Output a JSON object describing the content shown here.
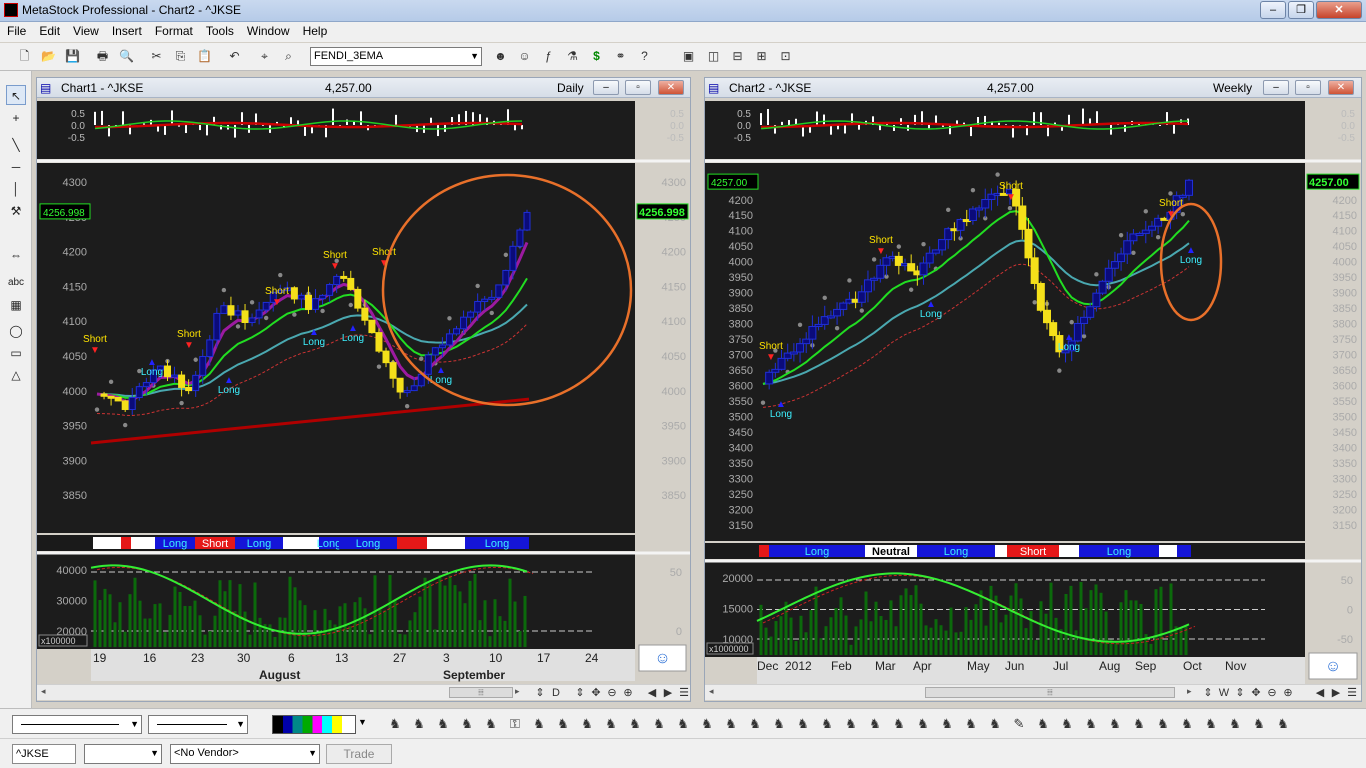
{
  "app": {
    "title": "MetaStock Professional - Chart2 - ^JKSE"
  },
  "menu": [
    "File",
    "Edit",
    "View",
    "Insert",
    "Format",
    "Tools",
    "Window",
    "Help"
  ],
  "toolbar": {
    "template": "FENDI_3EMA"
  },
  "chart1": {
    "title": "Chart1 - ^JKSE",
    "price": "4,257.00",
    "period": "Daily",
    "last_label": "4256.998",
    "osc_axis": [
      "0.5",
      "0.0",
      "-0.5"
    ],
    "price_axis": [
      "4300",
      "4250",
      "4200",
      "4150",
      "4100",
      "4050",
      "4000",
      "3950",
      "3900",
      "3850"
    ],
    "vol_axis": [
      "40000",
      "30000",
      "20000"
    ],
    "vol_unit": "x100000",
    "stoch_axis": [
      "50",
      "0"
    ],
    "dates": [
      "19",
      "16",
      "23",
      "30",
      "6",
      "13",
      "27",
      "3",
      "10",
      "17",
      "24"
    ],
    "months": [
      "August",
      "September"
    ],
    "signal_bar": [
      "Long",
      "Short",
      "Long",
      "Long",
      "Long"
    ],
    "annotations": [
      "Short",
      "Short",
      "Short",
      "Short",
      "Short",
      "Long",
      "Long",
      "Long",
      "Long",
      "Long"
    ]
  },
  "chart2": {
    "title": "Chart2 - ^JKSE",
    "price": "4,257.00",
    "period": "Weekly",
    "last_label": "4257.00",
    "osc_axis": [
      "0.5",
      "0.0",
      "-0.5"
    ],
    "price_axis": [
      "4250",
      "4200",
      "4150",
      "4100",
      "4050",
      "4000",
      "3950",
      "3900",
      "3850",
      "3800",
      "3750",
      "3700",
      "3650",
      "3600",
      "3550",
      "3500",
      "3450",
      "3400",
      "3350",
      "3300",
      "3250",
      "3200",
      "3150"
    ],
    "vol_axis": [
      "20000",
      "15000",
      "10000"
    ],
    "vol_unit": "x1000000",
    "stoch_axis": [
      "50",
      "0",
      "-50"
    ],
    "dates": [
      "Dec",
      "2012",
      "Feb",
      "Mar",
      "Apr",
      "May",
      "Jun",
      "Jul",
      "Aug",
      "Sep",
      "Oct",
      "Nov"
    ],
    "signal_bar": [
      "Long",
      "Neutral",
      "Long",
      "Short",
      "Long"
    ],
    "annotations": [
      "Short",
      "Short",
      "Short",
      "Short",
      "Long",
      "Long",
      "Long",
      "Long"
    ]
  },
  "scroll_labels": {
    "c1_right": "D",
    "c2_right": "W"
  },
  "status": {
    "symbol": "^JKSE",
    "vendor": "<No Vendor>",
    "trade": "Trade"
  },
  "colors": {
    "chart_bg": "#1c1c1c",
    "bull": "#1f2fd8",
    "bear": "#f4e01a",
    "ema_red": "#b00000",
    "ema_green": "#22dd22",
    "ema_purple": "#9c1aa0",
    "circle": "#e8702a"
  }
}
